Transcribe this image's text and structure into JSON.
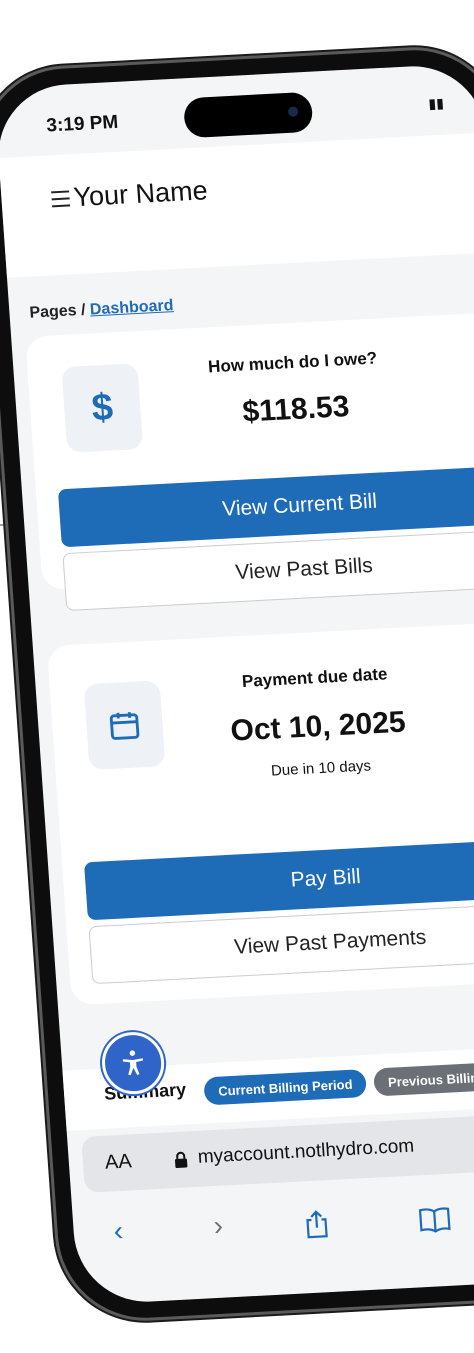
{
  "status": {
    "time": "3:19 PM"
  },
  "header": {
    "user_name": "Your Name",
    "menu_icon": "hamburger-menu-icon"
  },
  "breadcrumb": {
    "root": "Pages",
    "separator": "/",
    "current": "Dashboard"
  },
  "balance_card": {
    "icon": "dollar-icon",
    "label": "How much do I owe?",
    "amount": "$118.53",
    "primary_button": "View Current Bill",
    "secondary_button": "View Past Bills"
  },
  "due_card": {
    "icon": "calendar-icon",
    "label": "Payment due date",
    "date": "Oct 10, 2025",
    "subtext": "Due in 10 days",
    "primary_button": "Pay Bill",
    "secondary_button": "View Past Payments"
  },
  "summary": {
    "title": "Summary",
    "tabs": [
      "Current Billing Period",
      "Previous Billing"
    ]
  },
  "browser": {
    "aa_label": "AA",
    "url": "myaccount.notlhydro.com"
  },
  "colors": {
    "accent": "#1e6bb8",
    "accessibility": "#2f64c8",
    "inactive_tab": "#6b7077"
  }
}
